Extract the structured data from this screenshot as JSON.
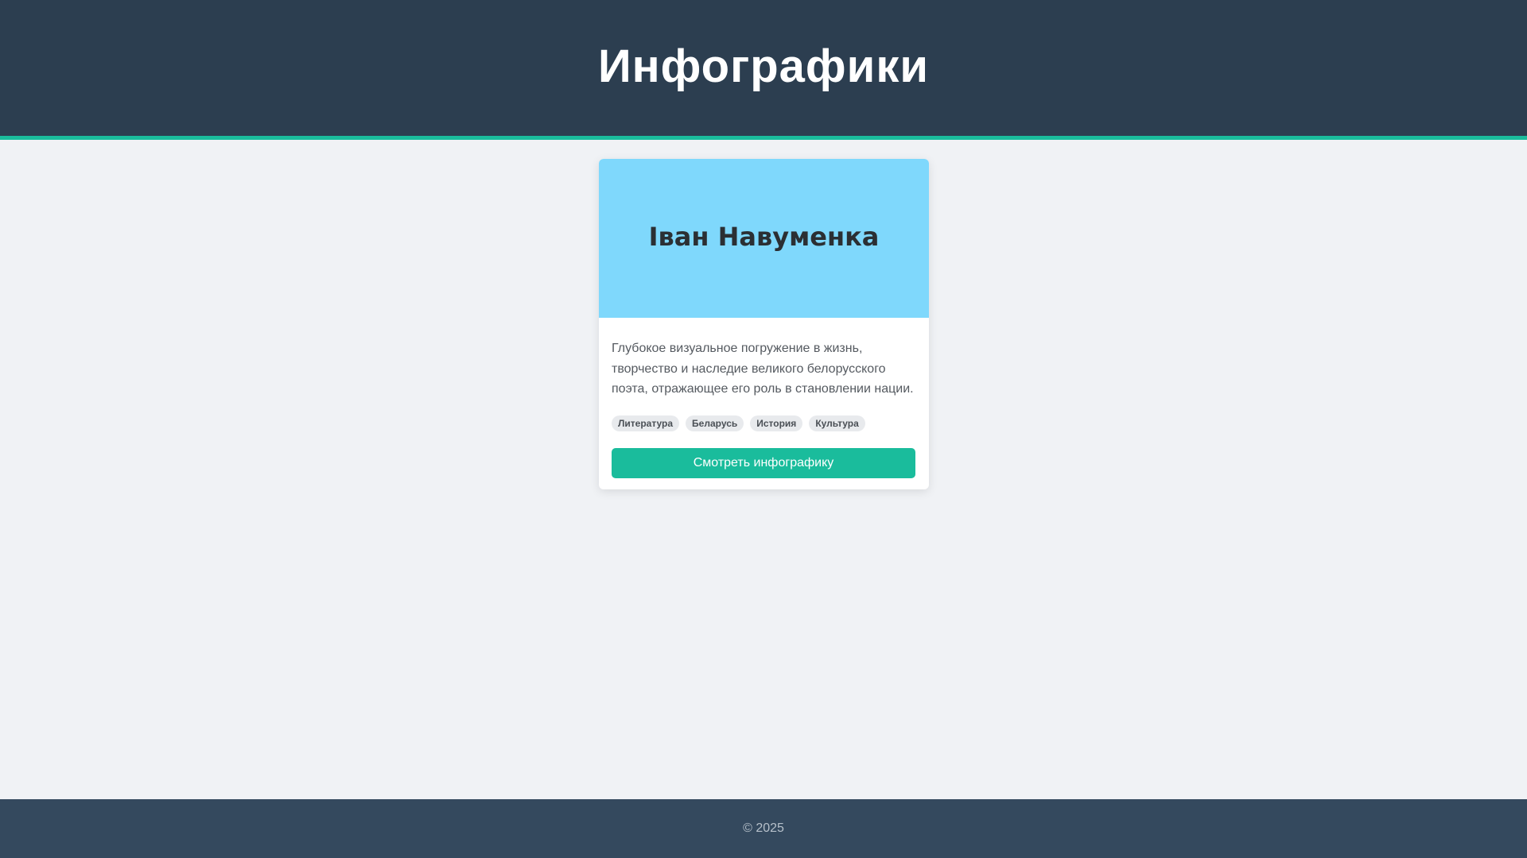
{
  "header": {
    "title": "Инфографики"
  },
  "card": {
    "banner_title": "Іван Навуменка",
    "description": "Глубокое визуальное погружение в жизнь, творчество и наследие великого белорусского поэта, отражающее его роль в становлении нации.",
    "tags": [
      "Литература",
      "Беларусь",
      "История",
      "Культура"
    ],
    "button_label": "Смотреть инфографику"
  },
  "footer": {
    "copyright": "© 2025"
  },
  "colors": {
    "header_bg": "#2c3e50",
    "accent": "#1abc9c",
    "banner_bg": "#7fd8fc",
    "footer_bg": "#34495e",
    "page_bg": "#f0f2f5"
  }
}
